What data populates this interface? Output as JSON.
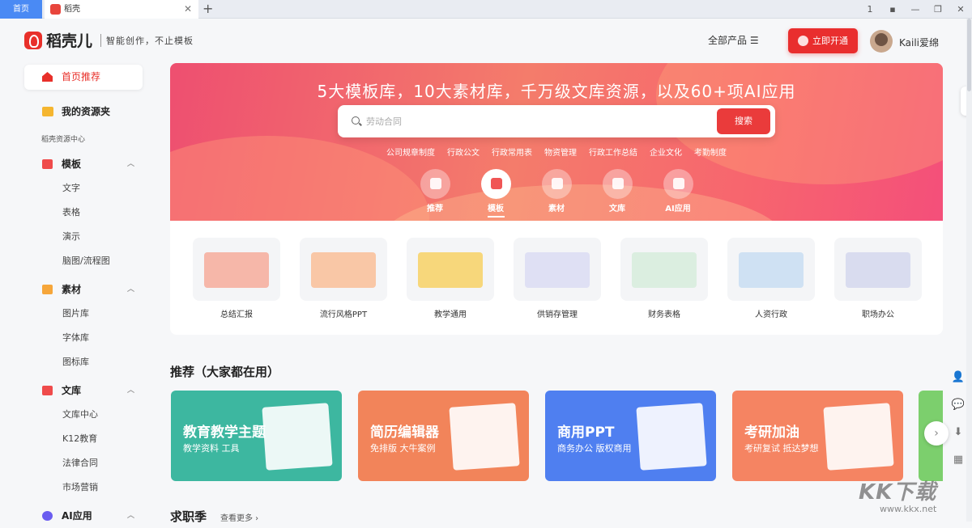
{
  "browser": {
    "home_tab": "首页",
    "active_tab": "稻壳",
    "close": "✕",
    "new_tab": "+",
    "window_controls": [
      "1",
      "▪",
      "—",
      "❐",
      "✕"
    ]
  },
  "header": {
    "logo": "稻壳儿",
    "slogan": "智能创作，不止模板",
    "all_products": "全部产品 ☰",
    "open_button": "立即开通",
    "username": "Kaili爱绵"
  },
  "sidebar": {
    "home": "首页推荐",
    "my_files": "我的资源夹",
    "section_label": "稻壳资源中心",
    "groups": [
      {
        "label": "模板",
        "items": [
          "文字",
          "表格",
          "演示",
          "脑图/流程图"
        ]
      },
      {
        "label": "素材",
        "items": [
          "图片库",
          "字体库",
          "图标库"
        ]
      },
      {
        "label": "文库",
        "items": [
          "文库中心",
          "K12教育",
          "法律合同",
          "市场营销"
        ]
      },
      {
        "label": "AI应用",
        "items": []
      }
    ]
  },
  "hero": {
    "title": "5大模板库，10大素材库，千万级文库资源，以及60+项AI应用",
    "search_placeholder": "劳动合同",
    "search_button": "搜索",
    "hot_keywords": [
      "公司规章制度",
      "行政公文",
      "行政常用表",
      "物资管理",
      "行政工作总结",
      "企业文化",
      "考勤制度"
    ],
    "categories": [
      "推荐",
      "模板",
      "素材",
      "文库",
      "AI应用"
    ],
    "active_category": "模板"
  },
  "templates": [
    {
      "label": "总结汇报",
      "color": "#f6b7a9"
    },
    {
      "label": "流行风格PPT",
      "color": "#f9c7a6"
    },
    {
      "label": "教学通用",
      "color": "#f7d77b"
    },
    {
      "label": "供销存管理",
      "color": "#dfe0f4"
    },
    {
      "label": "财务表格",
      "color": "#dbeee0"
    },
    {
      "label": "人资行政",
      "color": "#cfe1f3"
    },
    {
      "label": "职场办公",
      "color": "#d9dcef"
    }
  ],
  "recommend": {
    "title": "推荐（大家都在用）",
    "cards": [
      {
        "title": "教育教学主题",
        "subtitle": "教学资料 工具",
        "color": "#3db7a0"
      },
      {
        "title": "简历编辑器",
        "subtitle": "免排版 大牛案例",
        "color": "#f2845a"
      },
      {
        "title": "商用PPT",
        "subtitle": "商务办公 版权商用",
        "color": "#4f7ff0"
      },
      {
        "title": "考研加油",
        "subtitle": "考研复试 抵达梦想",
        "color": "#f58462"
      }
    ],
    "next": "›"
  },
  "jobs": {
    "title": "求职季",
    "more": "查看更多 ›"
  },
  "right_tools": [
    "👤",
    "💬",
    "⬇",
    "▦"
  ],
  "watermark": {
    "big": "KK下载",
    "small": "www.kkx.net"
  }
}
